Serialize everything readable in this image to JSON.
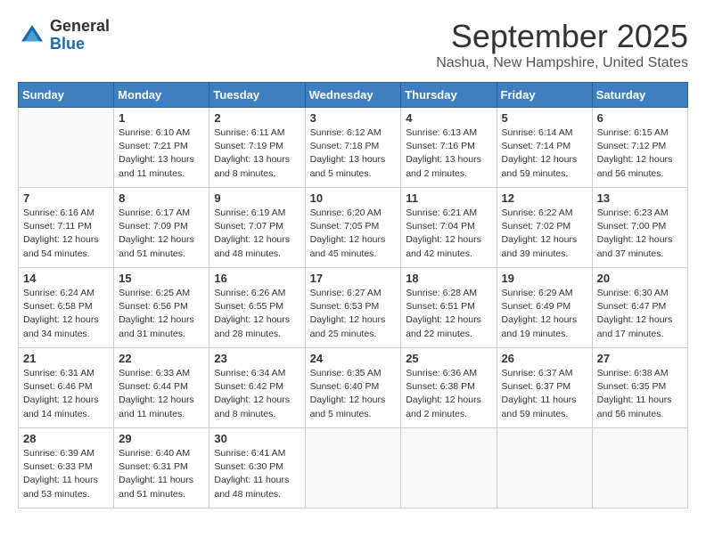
{
  "header": {
    "logo_general": "General",
    "logo_blue": "Blue",
    "month_title": "September 2025",
    "location": "Nashua, New Hampshire, United States"
  },
  "weekdays": [
    "Sunday",
    "Monday",
    "Tuesday",
    "Wednesday",
    "Thursday",
    "Friday",
    "Saturday"
  ],
  "weeks": [
    [
      {
        "day": "",
        "sunrise": "",
        "sunset": "",
        "daylight": ""
      },
      {
        "day": "1",
        "sunrise": "Sunrise: 6:10 AM",
        "sunset": "Sunset: 7:21 PM",
        "daylight": "Daylight: 13 hours and 11 minutes."
      },
      {
        "day": "2",
        "sunrise": "Sunrise: 6:11 AM",
        "sunset": "Sunset: 7:19 PM",
        "daylight": "Daylight: 13 hours and 8 minutes."
      },
      {
        "day": "3",
        "sunrise": "Sunrise: 6:12 AM",
        "sunset": "Sunset: 7:18 PM",
        "daylight": "Daylight: 13 hours and 5 minutes."
      },
      {
        "day": "4",
        "sunrise": "Sunrise: 6:13 AM",
        "sunset": "Sunset: 7:16 PM",
        "daylight": "Daylight: 13 hours and 2 minutes."
      },
      {
        "day": "5",
        "sunrise": "Sunrise: 6:14 AM",
        "sunset": "Sunset: 7:14 PM",
        "daylight": "Daylight: 12 hours and 59 minutes."
      },
      {
        "day": "6",
        "sunrise": "Sunrise: 6:15 AM",
        "sunset": "Sunset: 7:12 PM",
        "daylight": "Daylight: 12 hours and 56 minutes."
      }
    ],
    [
      {
        "day": "7",
        "sunrise": "Sunrise: 6:16 AM",
        "sunset": "Sunset: 7:11 PM",
        "daylight": "Daylight: 12 hours and 54 minutes."
      },
      {
        "day": "8",
        "sunrise": "Sunrise: 6:17 AM",
        "sunset": "Sunset: 7:09 PM",
        "daylight": "Daylight: 12 hours and 51 minutes."
      },
      {
        "day": "9",
        "sunrise": "Sunrise: 6:19 AM",
        "sunset": "Sunset: 7:07 PM",
        "daylight": "Daylight: 12 hours and 48 minutes."
      },
      {
        "day": "10",
        "sunrise": "Sunrise: 6:20 AM",
        "sunset": "Sunset: 7:05 PM",
        "daylight": "Daylight: 12 hours and 45 minutes."
      },
      {
        "day": "11",
        "sunrise": "Sunrise: 6:21 AM",
        "sunset": "Sunset: 7:04 PM",
        "daylight": "Daylight: 12 hours and 42 minutes."
      },
      {
        "day": "12",
        "sunrise": "Sunrise: 6:22 AM",
        "sunset": "Sunset: 7:02 PM",
        "daylight": "Daylight: 12 hours and 39 minutes."
      },
      {
        "day": "13",
        "sunrise": "Sunrise: 6:23 AM",
        "sunset": "Sunset: 7:00 PM",
        "daylight": "Daylight: 12 hours and 37 minutes."
      }
    ],
    [
      {
        "day": "14",
        "sunrise": "Sunrise: 6:24 AM",
        "sunset": "Sunset: 6:58 PM",
        "daylight": "Daylight: 12 hours and 34 minutes."
      },
      {
        "day": "15",
        "sunrise": "Sunrise: 6:25 AM",
        "sunset": "Sunset: 6:56 PM",
        "daylight": "Daylight: 12 hours and 31 minutes."
      },
      {
        "day": "16",
        "sunrise": "Sunrise: 6:26 AM",
        "sunset": "Sunset: 6:55 PM",
        "daylight": "Daylight: 12 hours and 28 minutes."
      },
      {
        "day": "17",
        "sunrise": "Sunrise: 6:27 AM",
        "sunset": "Sunset: 6:53 PM",
        "daylight": "Daylight: 12 hours and 25 minutes."
      },
      {
        "day": "18",
        "sunrise": "Sunrise: 6:28 AM",
        "sunset": "Sunset: 6:51 PM",
        "daylight": "Daylight: 12 hours and 22 minutes."
      },
      {
        "day": "19",
        "sunrise": "Sunrise: 6:29 AM",
        "sunset": "Sunset: 6:49 PM",
        "daylight": "Daylight: 12 hours and 19 minutes."
      },
      {
        "day": "20",
        "sunrise": "Sunrise: 6:30 AM",
        "sunset": "Sunset: 6:47 PM",
        "daylight": "Daylight: 12 hours and 17 minutes."
      }
    ],
    [
      {
        "day": "21",
        "sunrise": "Sunrise: 6:31 AM",
        "sunset": "Sunset: 6:46 PM",
        "daylight": "Daylight: 12 hours and 14 minutes."
      },
      {
        "day": "22",
        "sunrise": "Sunrise: 6:33 AM",
        "sunset": "Sunset: 6:44 PM",
        "daylight": "Daylight: 12 hours and 11 minutes."
      },
      {
        "day": "23",
        "sunrise": "Sunrise: 6:34 AM",
        "sunset": "Sunset: 6:42 PM",
        "daylight": "Daylight: 12 hours and 8 minutes."
      },
      {
        "day": "24",
        "sunrise": "Sunrise: 6:35 AM",
        "sunset": "Sunset: 6:40 PM",
        "daylight": "Daylight: 12 hours and 5 minutes."
      },
      {
        "day": "25",
        "sunrise": "Sunrise: 6:36 AM",
        "sunset": "Sunset: 6:38 PM",
        "daylight": "Daylight: 12 hours and 2 minutes."
      },
      {
        "day": "26",
        "sunrise": "Sunrise: 6:37 AM",
        "sunset": "Sunset: 6:37 PM",
        "daylight": "Daylight: 11 hours and 59 minutes."
      },
      {
        "day": "27",
        "sunrise": "Sunrise: 6:38 AM",
        "sunset": "Sunset: 6:35 PM",
        "daylight": "Daylight: 11 hours and 56 minutes."
      }
    ],
    [
      {
        "day": "28",
        "sunrise": "Sunrise: 6:39 AM",
        "sunset": "Sunset: 6:33 PM",
        "daylight": "Daylight: 11 hours and 53 minutes."
      },
      {
        "day": "29",
        "sunrise": "Sunrise: 6:40 AM",
        "sunset": "Sunset: 6:31 PM",
        "daylight": "Daylight: 11 hours and 51 minutes."
      },
      {
        "day": "30",
        "sunrise": "Sunrise: 6:41 AM",
        "sunset": "Sunset: 6:30 PM",
        "daylight": "Daylight: 11 hours and 48 minutes."
      },
      {
        "day": "",
        "sunrise": "",
        "sunset": "",
        "daylight": ""
      },
      {
        "day": "",
        "sunrise": "",
        "sunset": "",
        "daylight": ""
      },
      {
        "day": "",
        "sunrise": "",
        "sunset": "",
        "daylight": ""
      },
      {
        "day": "",
        "sunrise": "",
        "sunset": "",
        "daylight": ""
      }
    ]
  ]
}
